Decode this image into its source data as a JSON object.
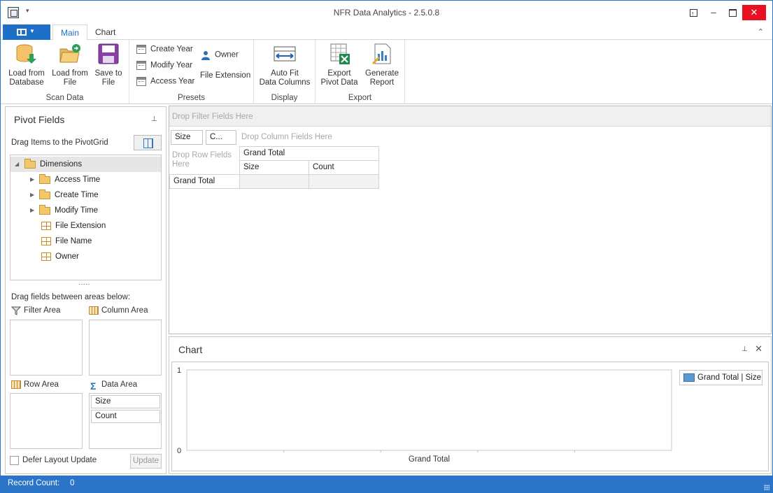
{
  "window": {
    "title": "NFR Data Analytics - 2.5.0.8",
    "controls": [
      "restore-ribbon",
      "minimize",
      "maximize",
      "close"
    ]
  },
  "ribbon": {
    "tabs": [
      {
        "label": "Main",
        "active": true
      },
      {
        "label": "Chart",
        "active": false
      }
    ],
    "groups": {
      "scan_data": {
        "label": "Scan Data",
        "load_db": "Load from\nDatabase",
        "load_file": "Load from\nFile",
        "save_file": "Save to\nFile"
      },
      "presets": {
        "label": "Presets",
        "create_year": "Create Year",
        "modify_year": "Modify Year",
        "access_year": "Access Year",
        "owner": "Owner",
        "file_extension": "File Extension"
      },
      "display": {
        "label": "Display",
        "auto_fit": "Auto Fit\nData Columns"
      },
      "export": {
        "label": "Export",
        "export_pivot": "Export\nPivot Data",
        "generate_report": "Generate\nReport"
      }
    }
  },
  "pivot_fields": {
    "title": "Pivot Fields",
    "drag_hint": "Drag Items to the PivotGrid",
    "tree": [
      {
        "label": "Dimensions",
        "type": "folder",
        "expanded": true,
        "selected": true
      },
      {
        "label": "Access Time",
        "type": "folder",
        "expanded": false
      },
      {
        "label": "Create Time",
        "type": "folder",
        "expanded": false
      },
      {
        "label": "Modify Time",
        "type": "folder",
        "expanded": false
      },
      {
        "label": "File Extension",
        "type": "field"
      },
      {
        "label": "File Name",
        "type": "field"
      },
      {
        "label": "Owner",
        "type": "field"
      }
    ],
    "areas_hint": "Drag fields between areas below:",
    "filter_area": "Filter Area",
    "column_area": "Column Area",
    "row_area": "Row Area",
    "data_area": "Data Area",
    "data_fields": [
      "Size",
      "Count"
    ],
    "defer_label": "Defer Layout Update",
    "defer_checked": false,
    "update_label": "Update"
  },
  "pivot_grid": {
    "filter_placeholder": "Drop Filter Fields Here",
    "data_chips": [
      "Size",
      "C..."
    ],
    "column_placeholder": "Drop Column Fields Here",
    "row_placeholder": "Drop Row Fields Here",
    "grand_total_header": "Grand Total",
    "col_headers": [
      "Size",
      "Count"
    ],
    "row_total_label": "Grand Total"
  },
  "chart_panel": {
    "title": "Chart",
    "legend": "Grand Total | Size",
    "colors": {
      "series": "#5b9bd5"
    }
  },
  "chart_data": {
    "type": "bar",
    "categories": [
      "Grand Total"
    ],
    "series": [
      {
        "name": "Grand Total | Size",
        "values": []
      }
    ],
    "ylim": [
      0,
      1
    ],
    "yticks": [
      "0",
      "1"
    ],
    "legend_position": "top-right",
    "grid": false
  },
  "status": {
    "label": "Record Count:",
    "value": "0"
  },
  "colors": {
    "accent": "#2b74c7",
    "close": "#e81123"
  }
}
